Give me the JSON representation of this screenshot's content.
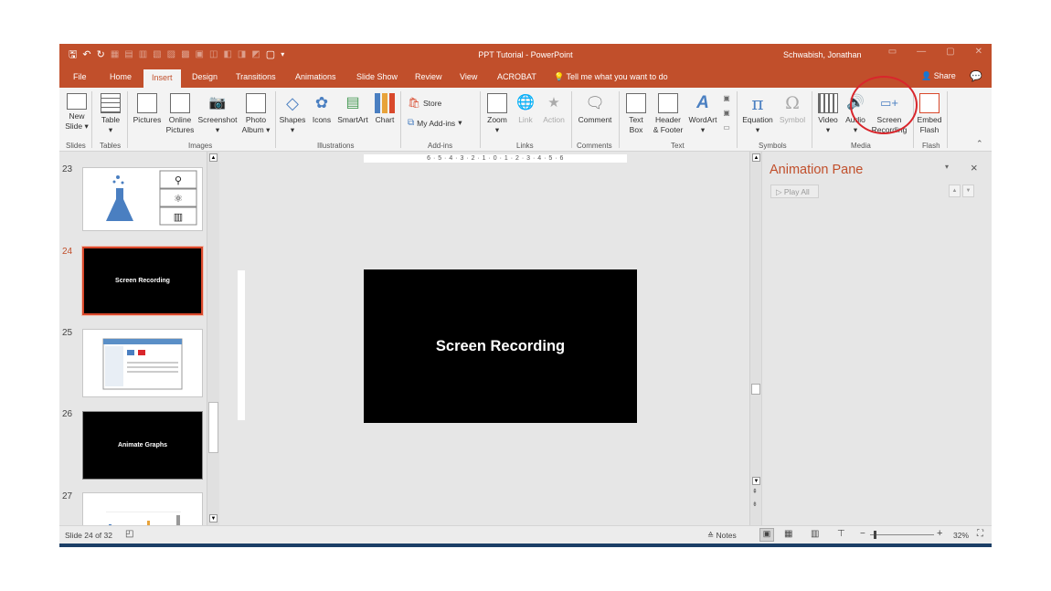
{
  "titlebar": {
    "doc_title": "PPT Tutorial  -  PowerPoint",
    "user": "Schwabish, Jonathan"
  },
  "tabs": [
    "File",
    "Home",
    "Insert",
    "Design",
    "Transitions",
    "Animations",
    "Slide Show",
    "Review",
    "View",
    "ACROBAT"
  ],
  "active_tab": "Insert",
  "tell_me": "Tell me what you want to do",
  "share": "Share",
  "ribbon": {
    "groups": {
      "slides": "Slides",
      "tables": "Tables",
      "images": "Images",
      "illustrations": "Illustrations",
      "addins": "Add-ins",
      "links": "Links",
      "comments": "Comments",
      "text": "Text",
      "symbols": "Symbols",
      "media": "Media",
      "flash": "Flash"
    },
    "buttons": {
      "new_slide_1": "New",
      "new_slide_2": "Slide",
      "table": "Table",
      "pictures": "Pictures",
      "online_pictures_1": "Online",
      "online_pictures_2": "Pictures",
      "screenshot": "Screenshot",
      "photo_album_1": "Photo",
      "photo_album_2": "Album",
      "shapes": "Shapes",
      "icons": "Icons",
      "smartart": "SmartArt",
      "chart": "Chart",
      "store": "Store",
      "my_addins": "My Add-ins",
      "zoom": "Zoom",
      "link": "Link",
      "action": "Action",
      "comment": "Comment",
      "text_box_1": "Text",
      "text_box_2": "Box",
      "header_footer_1": "Header",
      "header_footer_2": "& Footer",
      "wordart": "WordArt",
      "equation": "Equation",
      "symbol": "Symbol",
      "video": "Video",
      "audio": "Audio",
      "screen_recording_1": "Screen",
      "screen_recording_2": "Recording",
      "embed_flash_1": "Embed",
      "embed_flash_2": "Flash"
    }
  },
  "thumbnails": [
    {
      "num": "23",
      "title": ""
    },
    {
      "num": "24",
      "title": "Screen Recording"
    },
    {
      "num": "25",
      "title": ""
    },
    {
      "num": "26",
      "title": "Animate Graphs"
    },
    {
      "num": "27",
      "title": ""
    }
  ],
  "ruler_h": "6 · 5 · 4 · 3 · 2 · 1 · 0 · 1 · 2 · 3 · 4 · 5 · 6",
  "slide": {
    "title": "Screen Recording"
  },
  "animation_pane": {
    "title": "Animation Pane",
    "play_all": "Play All"
  },
  "status": {
    "slide_count": "Slide 24 of 32",
    "notes": "Notes",
    "zoom": "32%"
  }
}
